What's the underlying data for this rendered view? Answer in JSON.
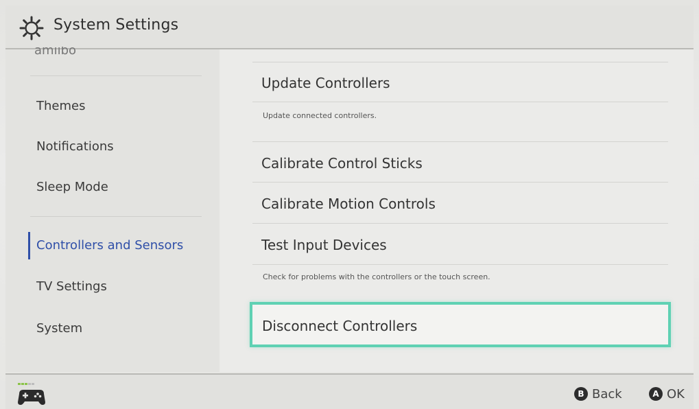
{
  "header": {
    "title": "System Settings",
    "icon": "gear-icon"
  },
  "sidebar": {
    "partial_item": "amiibo",
    "items": [
      {
        "label": "Themes"
      },
      {
        "label": "Notifications"
      },
      {
        "label": "Sleep Mode"
      },
      {
        "label": "Controllers and Sensors",
        "active": true
      },
      {
        "label": "TV Settings"
      },
      {
        "label": "System"
      }
    ],
    "active_color": "#2f4fa8"
  },
  "main": {
    "options": [
      {
        "label": "Update Controllers",
        "description": "Update connected controllers."
      },
      {
        "label": "Calibrate Control Sticks"
      },
      {
        "label": "Calibrate Motion Controls"
      },
      {
        "label": "Test Input Devices",
        "description": "Check for problems with the controllers or the touch screen."
      },
      {
        "label": "Disconnect Controllers",
        "selected": true
      }
    ],
    "selection_color": "#5fd1b3"
  },
  "footer": {
    "controller_icon": "controller-icon",
    "back_button": "B",
    "back_label": "Back",
    "ok_button": "A",
    "ok_label": "OK"
  }
}
